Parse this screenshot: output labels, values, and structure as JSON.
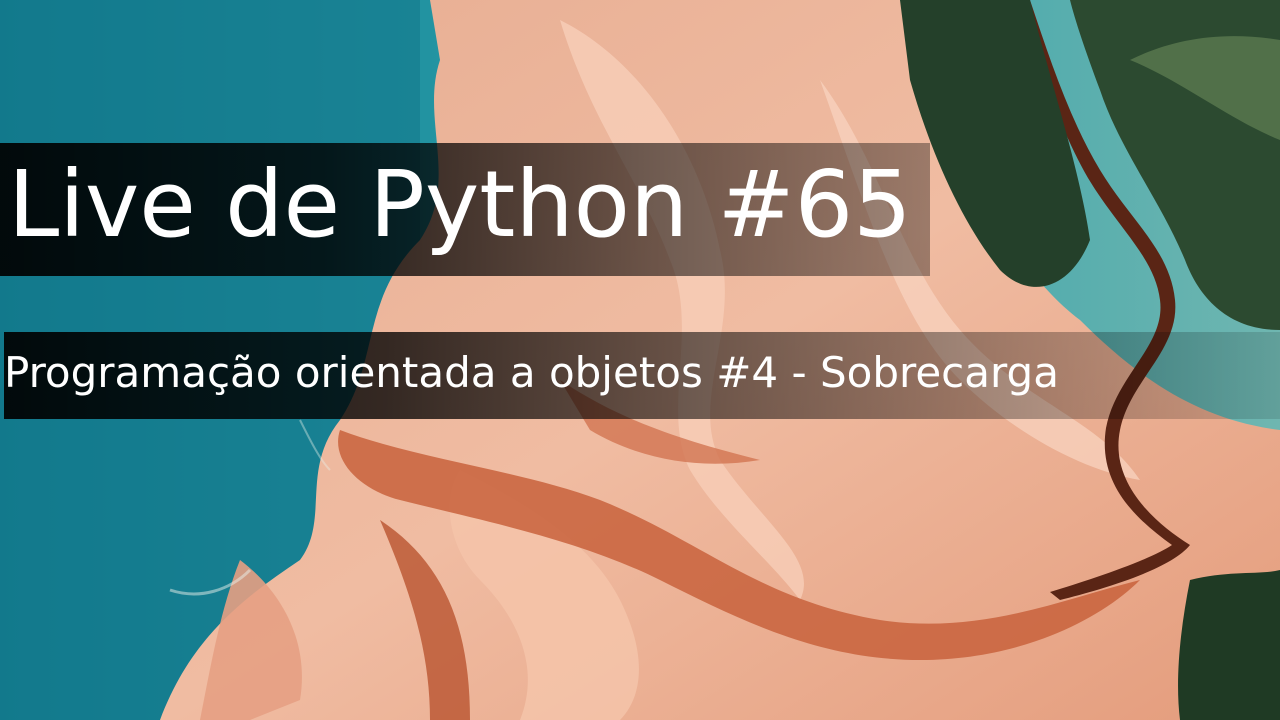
{
  "title": "Live de Python #65",
  "subtitle": "Programação orientada a objetos #4 - Sobrecarga",
  "background": {
    "description": "aerial view of turquoise water, pink-orange sand flats and green forest",
    "colors": {
      "water": "#1b8ea0",
      "water_deep": "#10707f",
      "sand_light": "#f2c0a6",
      "sand_mid": "#e59a78",
      "sand_dark": "#c05a35",
      "channel": "#5e2a18",
      "forest": "#24402a",
      "forest_dark": "#142a18"
    }
  },
  "overlay_color": "#000000",
  "text_color": "#ffffff"
}
